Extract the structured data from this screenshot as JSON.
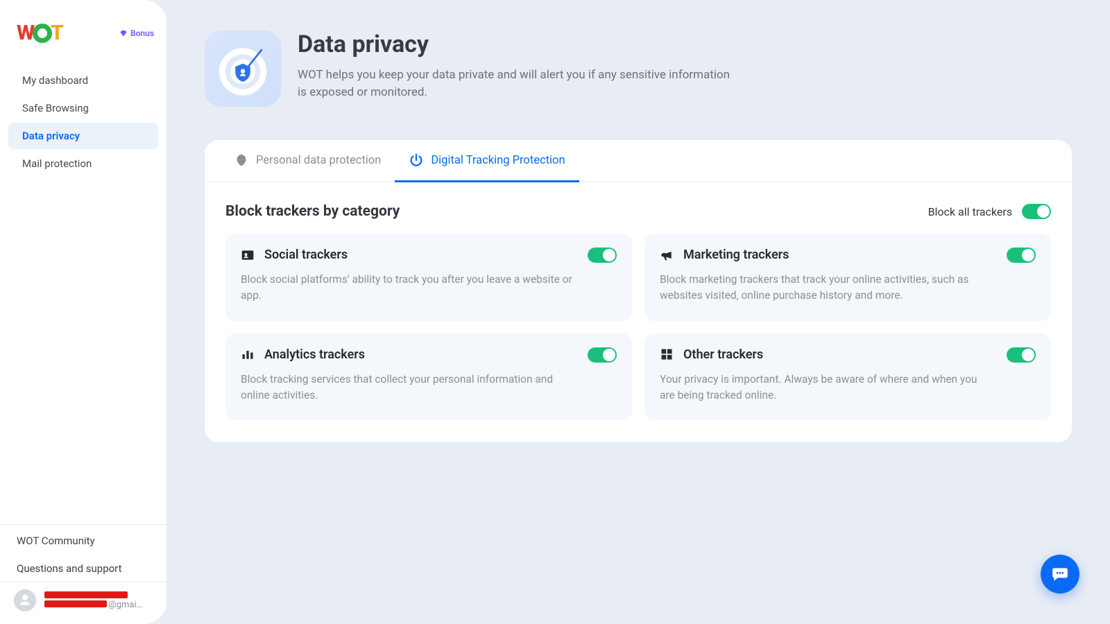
{
  "brand": "WOT",
  "header_bonus": "Bonus",
  "sidebar": {
    "items": [
      {
        "label": "My dashboard"
      },
      {
        "label": "Safe Browsing"
      },
      {
        "label": "Data privacy",
        "active": true
      },
      {
        "label": "Mail protection"
      }
    ]
  },
  "footer_links": {
    "community": "WOT Community",
    "support": "Questions and support"
  },
  "user": {
    "email_suffix": "@gmai…"
  },
  "page": {
    "title": "Data privacy",
    "subtitle": "WOT helps you keep your data private and will alert you if any sensitive information is exposed or monitored."
  },
  "tabs": {
    "personal": "Personal data protection",
    "tracking": "Digital Tracking Protection"
  },
  "section": {
    "title": "Block trackers by category",
    "block_all_label": "Block all trackers"
  },
  "cards": {
    "social": {
      "title": "Social trackers",
      "desc": "Block social platforms' ability to track you after you leave a website or app."
    },
    "marketing": {
      "title": "Marketing trackers",
      "desc": "Block marketing trackers that track your online activities, such as websites visited, online purchase history and more."
    },
    "analytics": {
      "title": "Analytics trackers",
      "desc": "Block tracking services that collect your personal information and online activities."
    },
    "other": {
      "title": "Other trackers",
      "desc": "Your privacy is important. Always be aware of where and when you are being tracked online."
    }
  }
}
